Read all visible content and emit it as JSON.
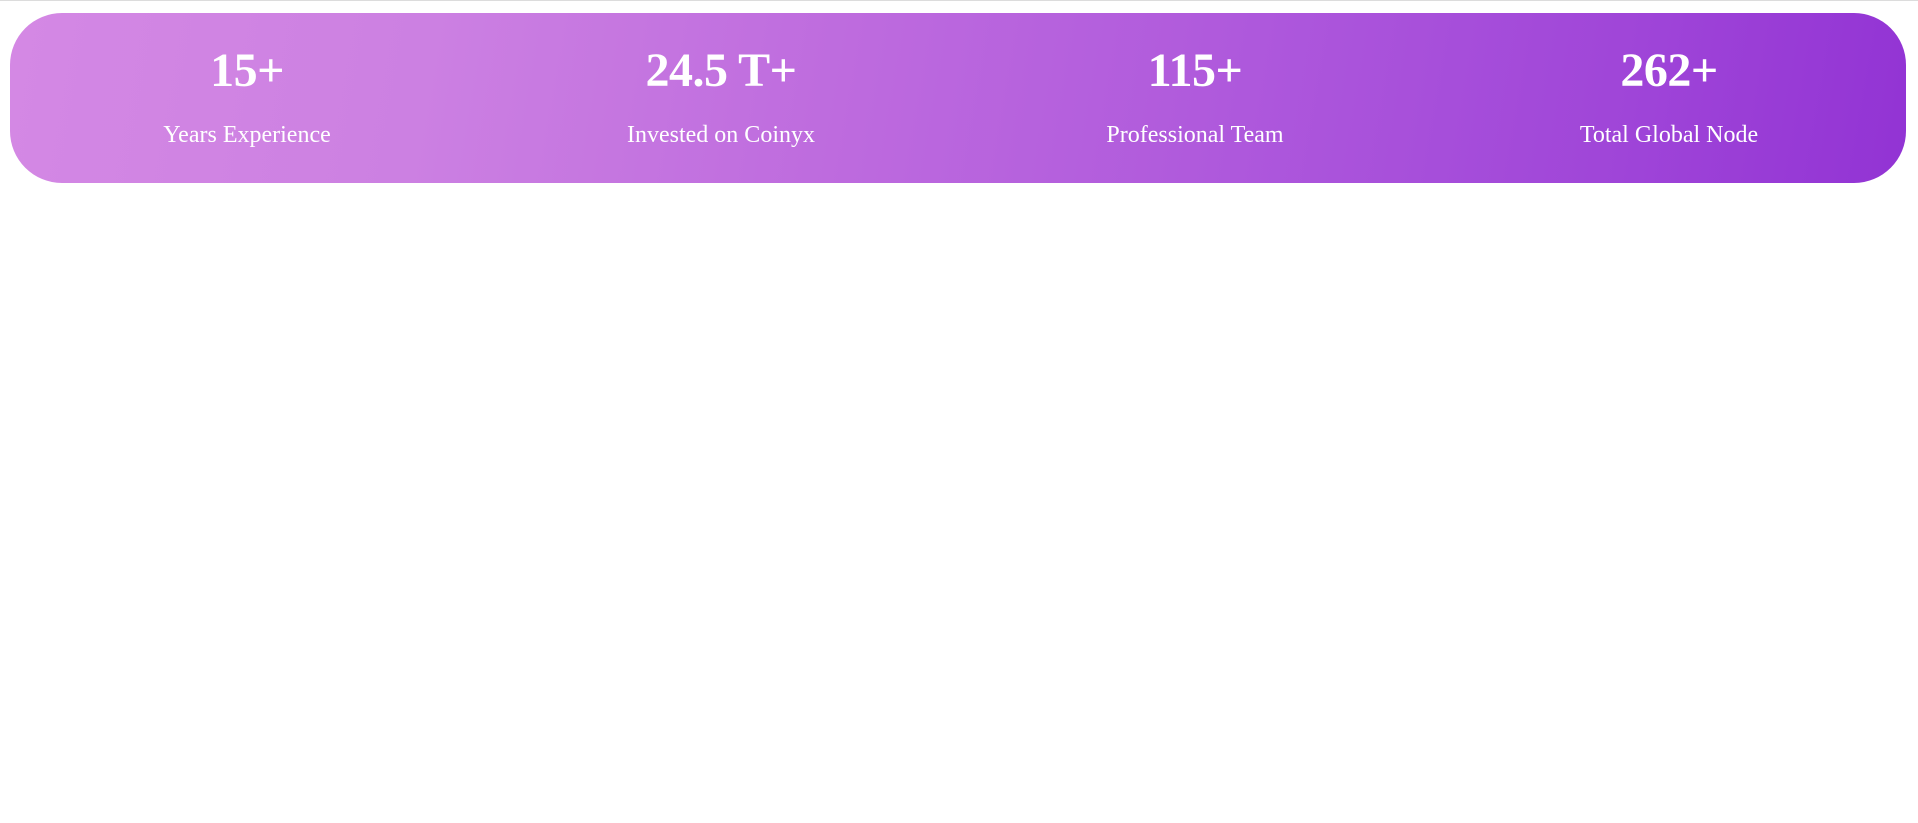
{
  "stats": [
    {
      "value": "15+",
      "label": "Years Experience"
    },
    {
      "value": "24.5 T+",
      "label": "Invested on Coinyx"
    },
    {
      "value": "115+",
      "label": "Professional Team"
    },
    {
      "value": "262+",
      "label": "Total Global Node"
    }
  ],
  "colors": {
    "gradient_start": "#d488e4",
    "gradient_end": "#9233d4",
    "text": "#ffffff"
  }
}
